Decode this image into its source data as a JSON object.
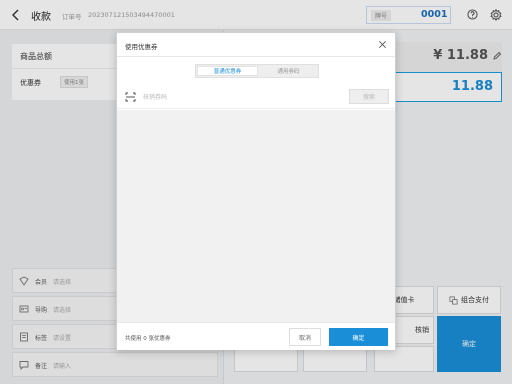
{
  "header": {
    "title": "收款",
    "order_label": "订单号",
    "order_no": "20230712150349447000​1",
    "plate_label": "牌号",
    "plate_no": "0001"
  },
  "summary": {
    "goods_total_label": "商品总额",
    "coupon_label": "优惠券",
    "coupon_tag": "使用1张"
  },
  "meta_rows": [
    {
      "label": "会员",
      "hint": "请选择",
      "icon": "member-icon"
    },
    {
      "label": "导购",
      "hint": "请选择",
      "icon": "guide-icon"
    },
    {
      "label": "标签",
      "hint": "请设置",
      "icon": "tag-icon"
    },
    {
      "label": "备注",
      "hint": "请输入",
      "icon": "note-icon"
    }
  ],
  "right": {
    "total_amount": "¥ 11.88",
    "payable_amount": "11.88",
    "buttons": {
      "card": "储值卡",
      "combo": "组合支付",
      "verify": "核销",
      "confirm": "确定"
    }
  },
  "modal": {
    "title": "使用优惠券",
    "tabs": [
      {
        "label": "普通优惠券",
        "active": true
      },
      {
        "label": "通用券码",
        "active": false
      }
    ],
    "search_placeholder": "核销券码",
    "search_label": "搜索",
    "footer_count": "共使用 0 张优惠券",
    "cancel_label": "取消",
    "ok_label": "确定"
  },
  "colors": {
    "accent": "#1a8fd8",
    "plate_text": "#1a6fc0"
  }
}
